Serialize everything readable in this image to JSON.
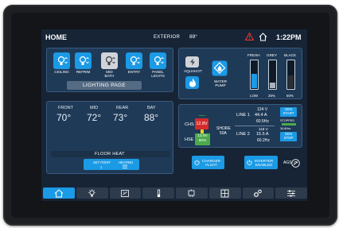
{
  "header": {
    "title": "HOME",
    "exterior_label": "EXTERIOR",
    "exterior_temp": "89°",
    "time": "1:22PM"
  },
  "lighting": {
    "buttons": [
      {
        "label": "CEILING",
        "on": true
      },
      {
        "label": "REFRIM",
        "on": true
      },
      {
        "label": "MID BATH",
        "on": false
      },
      {
        "label": "ENTRY",
        "on": true
      },
      {
        "label": "PANEL LIGHTS",
        "on": true
      }
    ],
    "page_button": "LIGHTING PAGE"
  },
  "pumps": {
    "aquahot_label": "AQUAHOT",
    "water_pump_label": "WATER PUMP"
  },
  "tanks": [
    {
      "label": "FRESH",
      "percent": "LOW",
      "level": 0.55,
      "color": "#1b9ae5"
    },
    {
      "label": "GREY",
      "percent": "25%",
      "level": 0.25,
      "color": "#aab4be"
    },
    {
      "label": "BLACK",
      "percent": "50%",
      "level": 0.5,
      "color": "#2a2f36"
    }
  ],
  "climate": {
    "zones": [
      {
        "label": "FRONT",
        "temp": "70°"
      },
      {
        "label": "MID",
        "temp": "72°"
      },
      {
        "label": "REAR",
        "temp": "73°"
      },
      {
        "label": "BAY",
        "temp": "88°"
      }
    ],
    "floor_heat_title": "FLOOR HEAT",
    "set_point_label": "SET POINT",
    "set_point_value": "1",
    "heating_label": "HEATING"
  },
  "power": {
    "chs_label": "CHS",
    "chs_voltage": "12.8V",
    "hse_label": "HSE",
    "hse_voltage": "13.9V",
    "hse_percent": "80%",
    "shore_label": "SHORE",
    "shore_amps": "50A",
    "line1_label": "LINE 1",
    "line1_voltage": "124 V",
    "line1_amps": "44.4 A",
    "line1_hz": "60.5Hz",
    "line2_label": "LINE 2",
    "line2_voltage": "118 V",
    "line2_amps": "15.5 A",
    "line2_hz": "60.2Hz",
    "gen_start": "GEN START",
    "gen_status": "STOPPED",
    "gen_hours": "34.8Hrs",
    "gen_stop": "GEN STOP",
    "charger_label": "CHARGER",
    "charger_state": "FLOAT",
    "inverter_label": "INVERTER",
    "inverter_state": "ENABLED",
    "ags_label": "AGS"
  },
  "nav": {
    "items": [
      "home-icon",
      "lightbulb-icon",
      "pump-icon",
      "thermometer-icon",
      "power-icon",
      "window-icon",
      "gear-icon",
      "sliders-icon"
    ]
  },
  "colors": {
    "accent": "#1b9ae5",
    "background": "#162436",
    "panel": "#1f3a57",
    "alert": "#d62b2b",
    "ok": "#4caa4d"
  }
}
